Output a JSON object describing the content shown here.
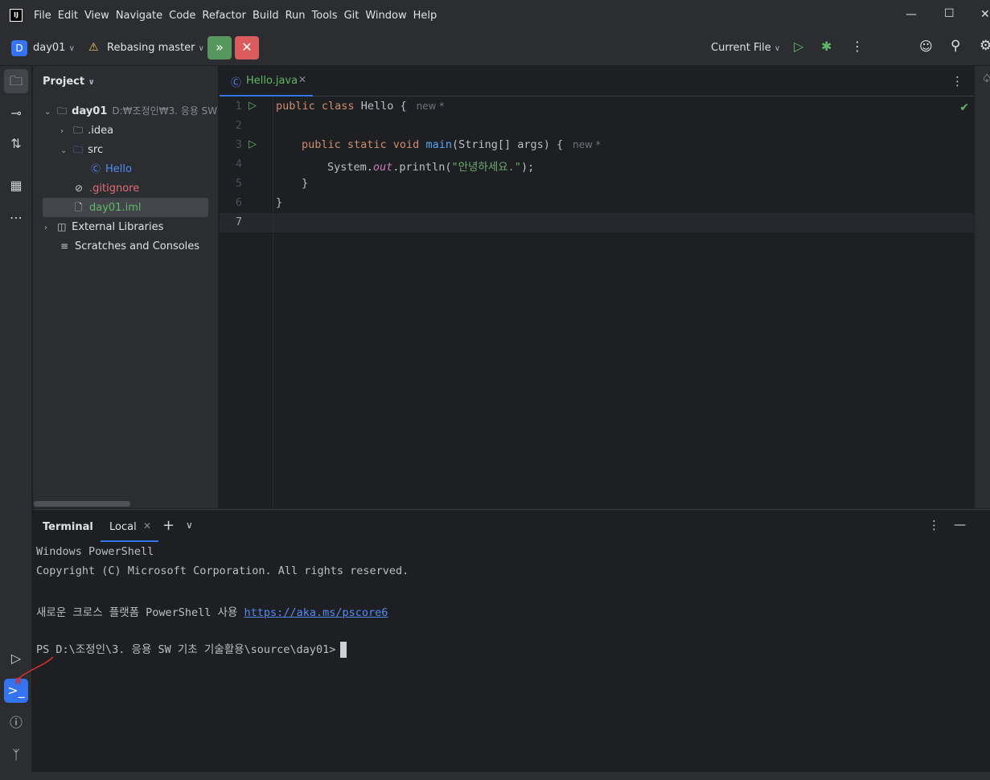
{
  "menubar": {
    "logo": "IJ",
    "items": [
      "File",
      "Edit",
      "View",
      "Navigate",
      "Code",
      "Refactor",
      "Build",
      "Run",
      "Tools",
      "Git",
      "Window",
      "Help"
    ]
  },
  "toolbar": {
    "project_badge": "D",
    "project_name": "day01",
    "vcs_status": "Rebasing master",
    "run_config": "Current File"
  },
  "project_panel": {
    "title": "Project",
    "tree": [
      {
        "label": "day01",
        "hint": "D:₩조정인₩3. 응용 SW",
        "icon": "module-folder-icon",
        "arrow": "⌄"
      },
      {
        "label": ".idea",
        "icon": "folder-icon",
        "arrow": "›"
      },
      {
        "label": "src",
        "icon": "source-folder-icon",
        "arrow": "⌄"
      },
      {
        "label": "Hello",
        "icon": "java-class-icon"
      },
      {
        "label": ".gitignore",
        "icon": "ignored-file-icon"
      },
      {
        "label": "day01.iml",
        "icon": "iml-file-icon"
      },
      {
        "label": "External Libraries",
        "icon": "library-icon",
        "arrow": "›"
      },
      {
        "label": "Scratches and Consoles",
        "icon": "scratches-icon"
      }
    ]
  },
  "editor": {
    "tab_label": "Hello.java",
    "line_numbers": [
      "1",
      "2",
      "3",
      "4",
      "5",
      "6",
      "7"
    ],
    "line1": {
      "kw": "public class",
      "name": "Hello {",
      "hint": "new *"
    },
    "line3": {
      "kw": "public static void",
      "fn": "main",
      "rest": "(String[] args) {",
      "hint": "new *"
    },
    "line4": {
      "a": "System.",
      "fld": "out",
      "b": ".println(",
      "str": "\"안녕하세요.\"",
      "c": ");"
    },
    "line5": "}",
    "line6": "}"
  },
  "terminal": {
    "title": "Terminal",
    "tab_label": "Local",
    "lines": [
      "Windows PowerShell",
      "Copyright (C) Microsoft Corporation. All rights reserved."
    ],
    "promo_text": "새로운 크로스 플랫폼 PowerShell 사용 ",
    "promo_link": "https://aka.ms/pscore6",
    "prompt": "PS D:\\조정인\\3. 응용 SW 기초 기술활용\\source\\day01>"
  },
  "colors": {
    "accent": "#3574f0",
    "run_green": "#5fb865",
    "abort_red": "#db5c5c",
    "warning": "#f2c55c"
  }
}
